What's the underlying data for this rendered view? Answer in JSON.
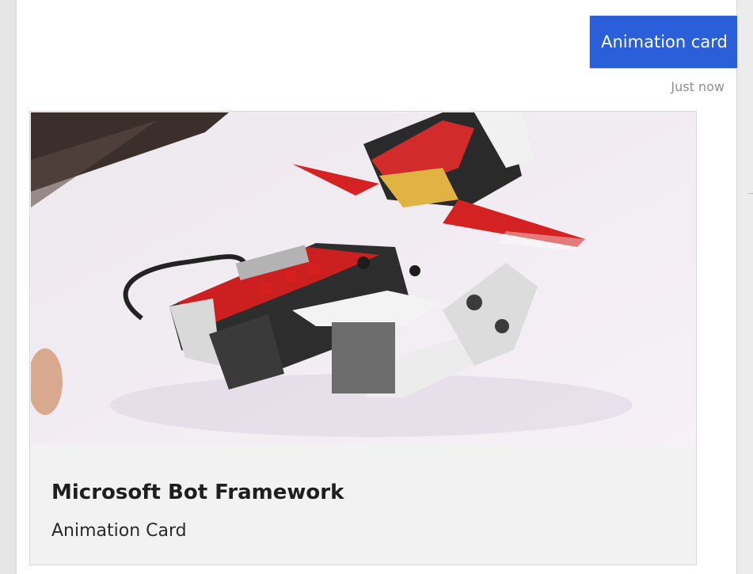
{
  "user_message": {
    "text": "Animation card",
    "timestamp": "Just now"
  },
  "card": {
    "media_icon": "animated-gif-robot-image",
    "title": "Microsoft Bot Framework",
    "subtitle": "Animation Card"
  },
  "colors": {
    "user_bubble": "#2b5fd9",
    "card_background": "#f2f2f2",
    "timestamp": "#8f8f8f"
  }
}
